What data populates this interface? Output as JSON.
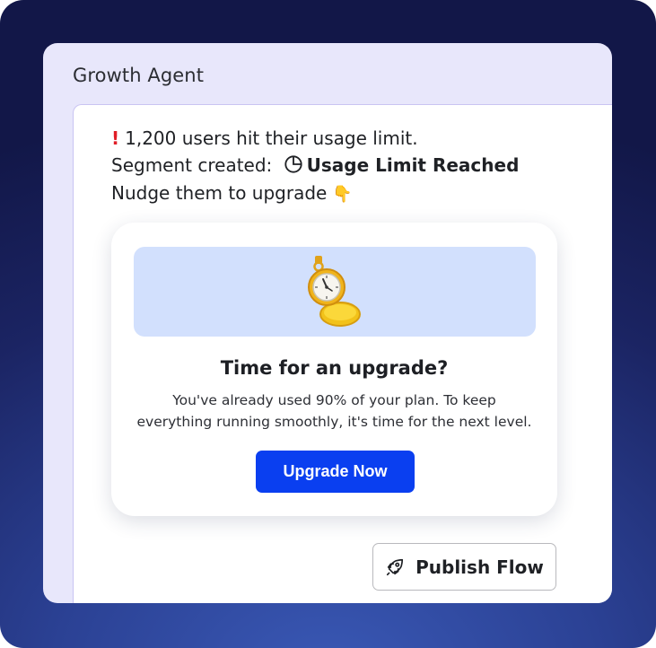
{
  "panel": {
    "title": "Growth Agent"
  },
  "message": {
    "line1": "1,200 users hit their usage limit.",
    "alert_icon": "exclamation-icon",
    "line2_prefix": "Segment created:",
    "segment_icon": "pie-chart-icon",
    "segment_name": "Usage Limit Reached",
    "line3": "Nudge them to upgrade",
    "pointer_emoji": "👇"
  },
  "card": {
    "illustration": "stopwatch-icon",
    "title": "Time for an upgrade?",
    "body_line1": "You've already used 90% of your plan. To keep",
    "body_line2": "everything running smoothly, it's time for the next level.",
    "cta_label": "Upgrade Now"
  },
  "actions": {
    "publish_label": "Publish Flow",
    "publish_icon": "rocket-icon"
  },
  "colors": {
    "accent": "#0a3ff0",
    "banner": "#d2e0fd",
    "alert": "#e11d27"
  }
}
